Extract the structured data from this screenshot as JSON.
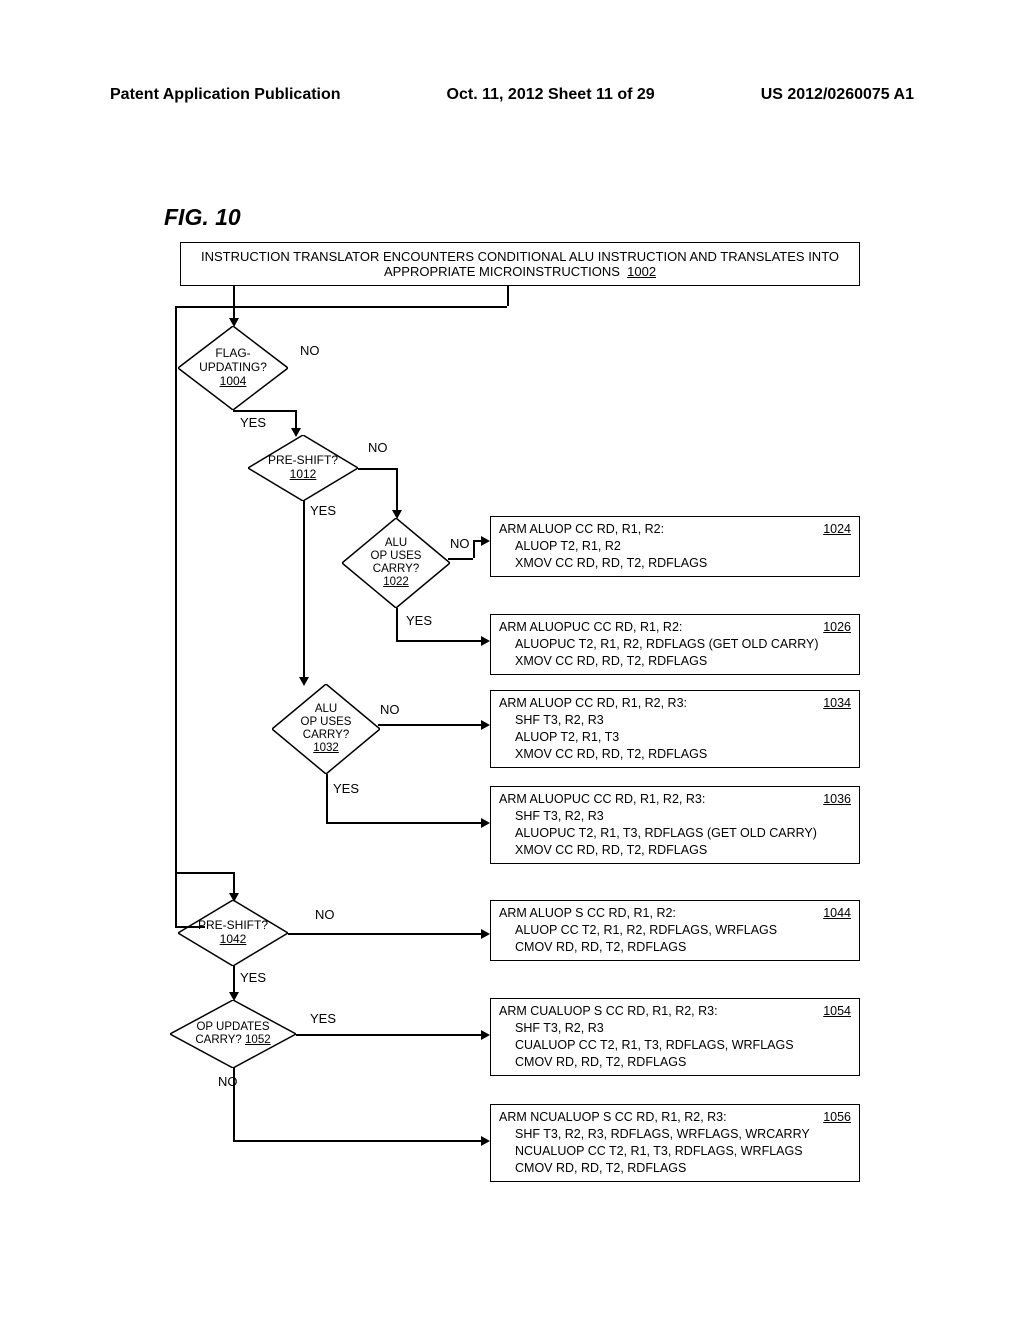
{
  "header": {
    "left": "Patent Application Publication",
    "center": "Oct. 11, 2012  Sheet 11 of 29",
    "right": "US 2012/0260075 A1"
  },
  "figure_label": "FIG. 10",
  "start": {
    "text": "INSTRUCTION TRANSLATOR ENCOUNTERS CONDITIONAL ALU INSTRUCTION AND TRANSLATES INTO APPROPRIATE MICROINSTRUCTIONS",
    "ref": "1002"
  },
  "labels": {
    "yes": "YES",
    "no": "NO"
  },
  "d1004": {
    "l1": "FLAG-",
    "l2": "UPDATING?",
    "ref": "1004"
  },
  "d1012": {
    "l1": "PRE-SHIFT?",
    "ref": "1012"
  },
  "d1022": {
    "l1": "ALU",
    "l2": "OP USES",
    "l3": "CARRY?",
    "ref": "1022"
  },
  "d1032": {
    "l1": "ALU",
    "l2": "OP USES",
    "l3": "CARRY?",
    "ref": "1032"
  },
  "d1042": {
    "l1": "PRE-SHIFT?",
    "ref": "1042"
  },
  "d1052": {
    "l1": "OP UPDATES",
    "l2": "CARRY?",
    "ref": "1052"
  },
  "r1024": {
    "title": "ARM ALUOP CC RD, R1, R2:",
    "ref": "1024",
    "l1": "ALUOP T2, R1, R2",
    "l2": "XMOV CC RD, RD, T2, RDFLAGS"
  },
  "r1026": {
    "title": "ARM ALUOPUC CC RD, R1, R2:",
    "ref": "1026",
    "l1": "ALUOPUC T2, R1, R2, RDFLAGS (GET OLD CARRY)",
    "l2": "XMOV CC RD, RD, T2, RDFLAGS"
  },
  "r1034": {
    "title": "ARM ALUOP CC RD, R1, R2, R3:",
    "ref": "1034",
    "l1": "SHF T3, R2, R3",
    "l2": "ALUOP T2, R1, T3",
    "l3": "XMOV CC RD, RD, T2, RDFLAGS"
  },
  "r1036": {
    "title": "ARM ALUOPUC CC RD, R1, R2, R3:",
    "ref": "1036",
    "l1": "SHF T3, R2, R3",
    "l2": "ALUOPUC T2, R1, T3, RDFLAGS (GET OLD CARRY)",
    "l3": "XMOV CC RD, RD, T2, RDFLAGS"
  },
  "r1044": {
    "title": "ARM ALUOP S CC RD, R1, R2:",
    "ref": "1044",
    "l1": "ALUOP CC T2, R1, R2, RDFLAGS, WRFLAGS",
    "l2": "CMOV RD, RD, T2, RDFLAGS"
  },
  "r1054": {
    "title": "ARM CUALUOP S CC RD, R1, R2, R3:",
    "ref": "1054",
    "l1": "SHF T3, R2, R3",
    "l2": "CUALUOP CC T2, R1, T3, RDFLAGS, WRFLAGS",
    "l3": "CMOV RD, RD, T2, RDFLAGS"
  },
  "r1056": {
    "title": "ARM NCUALUOP S CC RD, R1, R2, R3:",
    "ref": "1056",
    "l1": "SHF T3, R2, R3, RDFLAGS, WRFLAGS, WRCARRY",
    "l2": "NCUALUOP CC T2, R1, T3, RDFLAGS, WRFLAGS",
    "l3": "CMOV RD, RD, T2, RDFLAGS"
  }
}
